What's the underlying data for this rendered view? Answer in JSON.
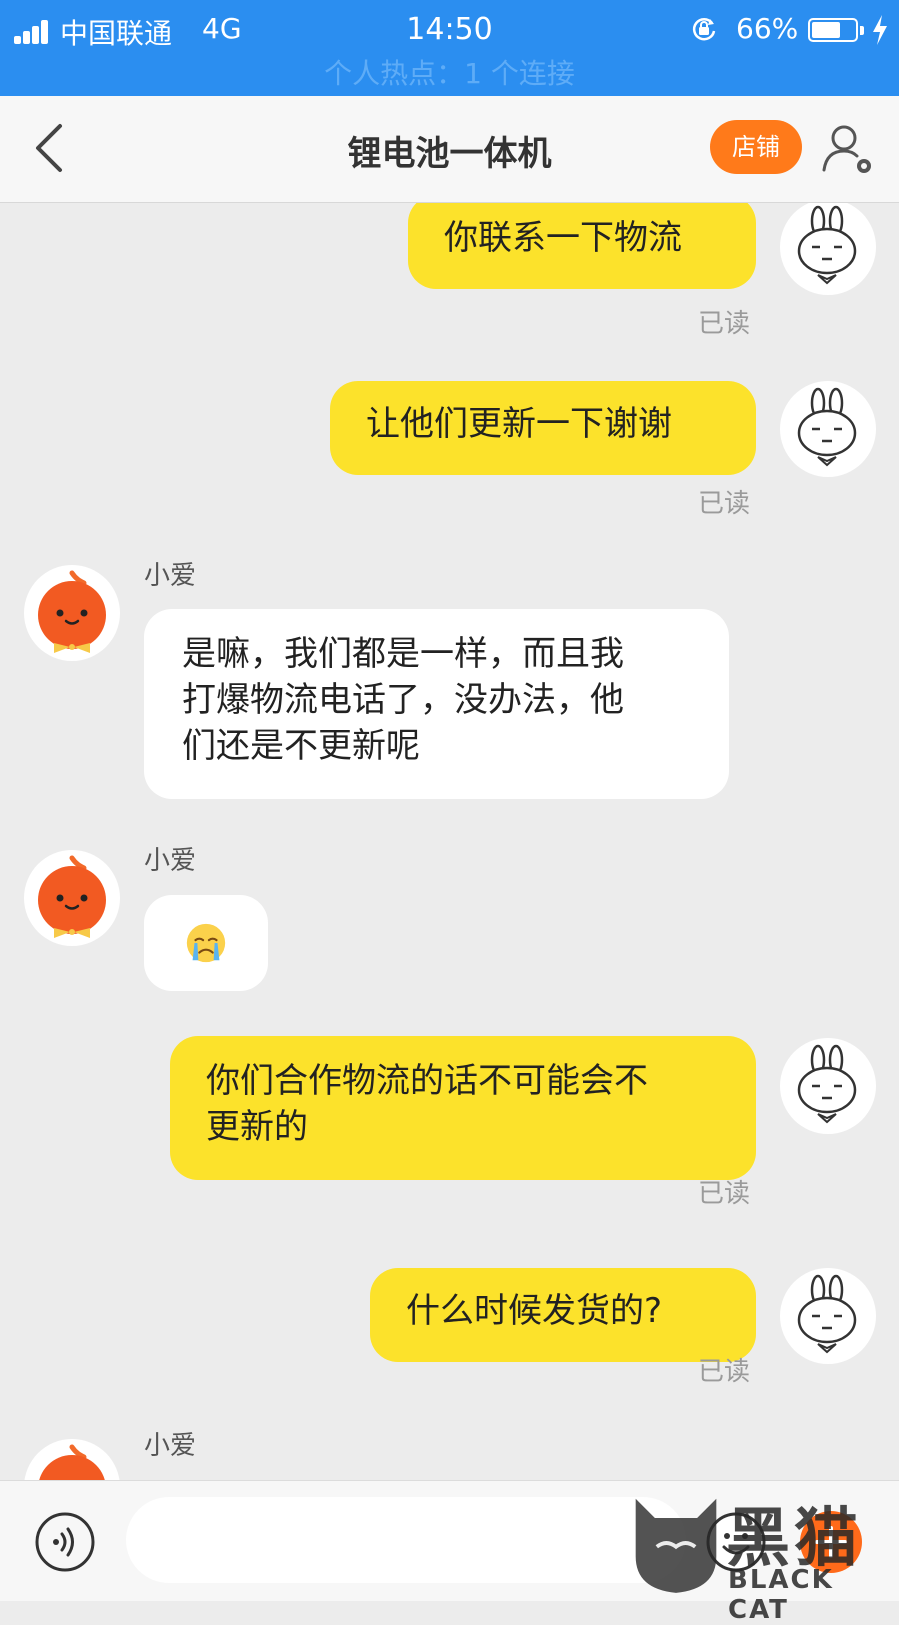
{
  "status_bar": {
    "carrier": "中国联通",
    "network": "4G",
    "time": "14:50",
    "battery_percent": "66%",
    "battery_level": 0.66,
    "hotspot_text": "个人热点：1 个连接"
  },
  "nav": {
    "title": "锂电池一体机",
    "shop_label": "店铺"
  },
  "messages": [
    {
      "side": "me",
      "text": "你联系一下物流",
      "status": "已读"
    },
    {
      "side": "me",
      "text": "让他们更新一下谢谢",
      "status": "已读"
    },
    {
      "side": "them",
      "sender": "小爱",
      "lines": [
        "是嘛，我们都是一样，而且我",
        "打爆物流电话了，没办法，他",
        "们还是不更新呢"
      ]
    },
    {
      "side": "them",
      "sender": "小爱",
      "emoji": "crying-face-icon"
    },
    {
      "side": "me",
      "lines": [
        "你们合作物流的话不可能会不",
        "更新的"
      ],
      "status": "已读"
    },
    {
      "side": "me",
      "text": "什么时候发货的?",
      "status": "已读"
    },
    {
      "side": "them",
      "sender": "小爱"
    }
  ],
  "input": {
    "value": "",
    "placeholder": ""
  },
  "watermark": {
    "text": "黑猫",
    "sub": "BLACK CAT"
  },
  "colors": {
    "status_bar": "#2b8ef0",
    "my_bubble": "#fce22b",
    "their_bubble": "#ffffff",
    "shop_button": "#ff7a1a",
    "chat_bg": "#ececec"
  },
  "icons": [
    "signal-icon",
    "rotation-lock-icon",
    "battery-icon",
    "charging-icon",
    "back-icon",
    "user-settings-icon",
    "rabbit-avatar-icon",
    "orange-mascot-avatar-icon",
    "crying-face-icon",
    "voice-icon",
    "emoji-icon",
    "plus-icon"
  ]
}
